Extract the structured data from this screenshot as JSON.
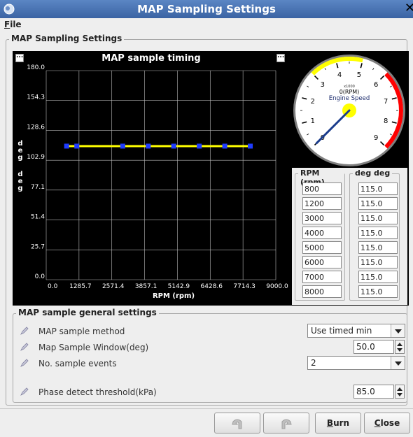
{
  "window": {
    "title": "MAP Sampling Settings"
  },
  "menu": {
    "file_label": "File"
  },
  "main_group": {
    "label": "MAP Sampling Settings"
  },
  "chart": {
    "title": "MAP sample timing",
    "corner_button": "...",
    "ylabel": "deg",
    "xlabel": "RPM (rpm)"
  },
  "chart_data": {
    "type": "line",
    "title": "MAP sample timing",
    "xlabel": "RPM (rpm)",
    "ylabel": "deg",
    "xlim": [
      0,
      9000
    ],
    "ylim": [
      0,
      180
    ],
    "x_ticks": [
      "0.0",
      "1285.7",
      "2571.4",
      "3857.1",
      "5142.9",
      "6428.6",
      "7714.3",
      "9000.0"
    ],
    "y_ticks": [
      "0.0",
      "25.7",
      "51.4",
      "77.1",
      "102.9",
      "128.6",
      "154.3",
      "180.0"
    ],
    "grid": true,
    "series": [
      {
        "x": [
          800,
          1200,
          3000,
          4000,
          5000,
          6000,
          7000,
          8000
        ],
        "y": [
          115.0,
          115.0,
          115.0,
          115.0,
          115.0,
          115.0,
          115.0,
          115.0
        ]
      }
    ]
  },
  "gauge": {
    "multiplier": "x1000",
    "value_text": "0(RPM)",
    "label": "Engine Speed",
    "ticks": [
      "0",
      "1",
      "2",
      "3",
      "4",
      "5",
      "6",
      "7",
      "8",
      "9"
    ],
    "min": 0,
    "max": 9,
    "value": 0,
    "colors": {
      "warn": "#ffff00",
      "danger": "#ff0000",
      "needle": "#1a3c8c"
    }
  },
  "table": {
    "rpm_header": "RPM (rpm)",
    "deg_header": "deg deg",
    "rpm": [
      "800",
      "1200",
      "3000",
      "4000",
      "5000",
      "6000",
      "7000",
      "8000"
    ],
    "deg": [
      "115.0",
      "115.0",
      "115.0",
      "115.0",
      "115.0",
      "115.0",
      "115.0",
      "115.0"
    ]
  },
  "general": {
    "label": "MAP sample general settings",
    "method_label": "MAP sample method",
    "method_value": "Use timed min",
    "window_label": "Map Sample Window(deg)",
    "window_value": "50.0",
    "events_label": "No. sample events",
    "events_value": "2",
    "threshold_label": "Phase detect threshold(kPa)",
    "threshold_value": "85.0"
  },
  "buttons": {
    "burn_label": "Burn",
    "close_label": "Close"
  }
}
